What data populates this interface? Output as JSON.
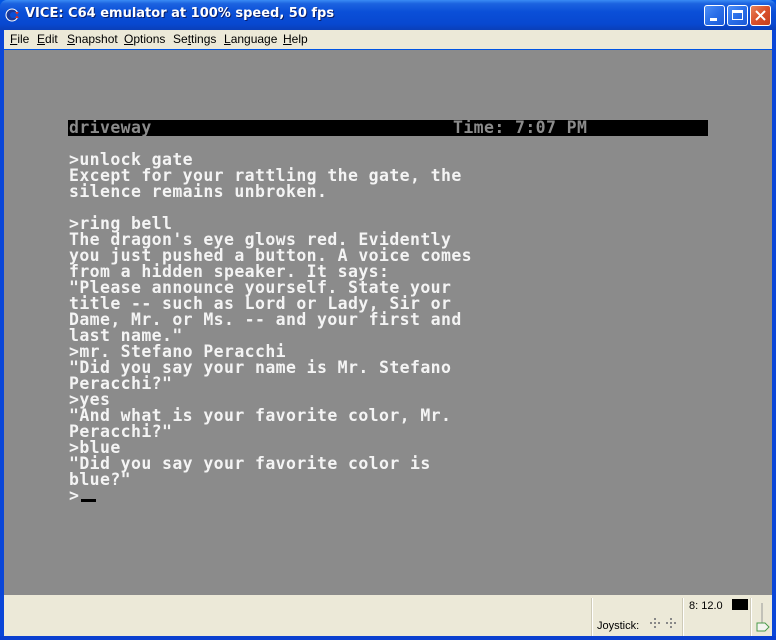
{
  "window": {
    "title": "VICE: C64 emulator at 100% speed, 50 fps",
    "controls": [
      "minimize",
      "maximize",
      "close"
    ]
  },
  "menu": {
    "items": [
      {
        "label": "File",
        "accel": "F",
        "rest": "ile"
      },
      {
        "label": "Edit",
        "accel": "E",
        "rest": "dit"
      },
      {
        "label": "Snapshot",
        "accel": "S",
        "rest": "napshot"
      },
      {
        "label": "Options",
        "accel": "O",
        "rest": "ptions"
      },
      {
        "label": "Settings",
        "pre": "Se",
        "accel": "t",
        "rest": "tings"
      },
      {
        "label": "Language",
        "accel": "L",
        "rest": "anguage"
      },
      {
        "label": "Help",
        "accel": "H",
        "rest": "elp"
      }
    ]
  },
  "c64": {
    "status": {
      "location": "driveway",
      "time": "Time: 7:07 PM"
    },
    "lines": [
      ">unlock gate",
      "Except for your rattling the gate, the",
      "silence remains unbroken.",
      "",
      ">ring bell",
      "The dragon's eye glows red. Evidently",
      "you just pushed a button. A voice comes",
      "from a hidden speaker. It says:",
      "\"Please announce yourself. State your",
      "title -- such as Lord or Lady, Sir or",
      "Dame, Mr. or Ms. -- and your first and",
      "last name.\"",
      ">mr. Stefano Peracchi",
      "\"Did you say your name is Mr. Stefano",
      "Peracchi?\"",
      ">yes",
      "\"And what is your favorite color, Mr.",
      "Peracchi?\"",
      ">blue",
      "\"Did you say your favorite color is",
      "blue?\""
    ],
    "prompt": ">",
    "colors": {
      "background": "#8b8b8b",
      "text": "#f4f4f4",
      "status_bg": "#000000"
    }
  },
  "statusbar": {
    "joystick_label": "Joystick:",
    "drive_label": "8: 12.0",
    "drive_led_color": "#000000"
  }
}
